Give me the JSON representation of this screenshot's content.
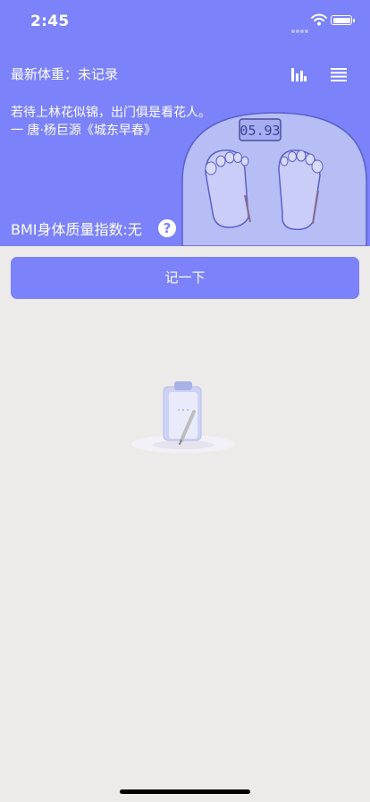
{
  "status_bar": {
    "time": "2:45"
  },
  "header": {
    "latest_weight_label": "最新体重：",
    "latest_weight_value": "未记录",
    "quote_line1": "若待上林花似锦，出门俱是看花人。",
    "quote_line2": "一 唐·杨巨源《城东早春》",
    "scale_reading": "05.93",
    "bmi_label": "BMI身体质量指数: ",
    "bmi_value": "无",
    "help_symbol": "?"
  },
  "actions": {
    "record_label": "记一下"
  },
  "colors": {
    "accent": "#7b82fa",
    "background": "#edeaea"
  },
  "icons": {
    "stats": "bar-chart-icon",
    "menu": "list-menu-icon",
    "help": "question-icon",
    "wifi": "wifi-icon",
    "battery": "battery-icon",
    "empty": "clipboard-empty-icon"
  }
}
